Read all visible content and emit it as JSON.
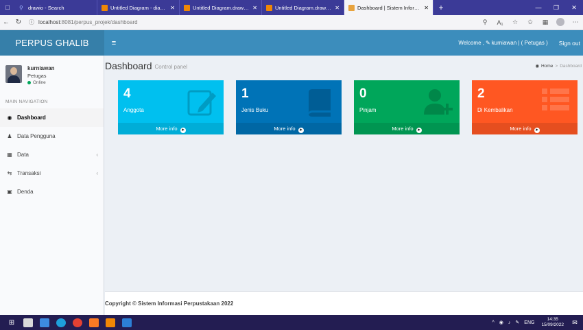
{
  "browser": {
    "tabs": [
      {
        "title": "drawio - Search",
        "favicon_color": "#3b3a97",
        "active": false
      },
      {
        "title": "Untitled Diagram - diagrams",
        "favicon_color": "#f08705",
        "active": false
      },
      {
        "title": "Untitled Diagram.drawio - d",
        "favicon_color": "#f08705",
        "active": false
      },
      {
        "title": "Untitled Diagram.drawio - d",
        "favicon_color": "#f08705",
        "active": false
      },
      {
        "title": "Dashboard | Sistem Informasi",
        "favicon_color": "#e8a33d",
        "active": true
      }
    ],
    "address": {
      "host": "localhost",
      "path": ":8081/perpus_projek/dashboard"
    }
  },
  "header": {
    "logo": "PERPUS GHALIB",
    "welcome": "Welcome ,",
    "user_link": "kurniawan | ( Petugas )",
    "signout": "Sign out"
  },
  "sidebar": {
    "user": {
      "name": "kurniawan",
      "role": "Petugas",
      "status": "Online"
    },
    "nav_header": "MAIN NAVIGATION",
    "items": [
      {
        "label": "Dashboard",
        "icon": "dashboard-icon",
        "active": true
      },
      {
        "label": "Data Pengguna",
        "icon": "user-icon"
      },
      {
        "label": "Data",
        "icon": "data-icon",
        "caret": true
      },
      {
        "label": "Transaksi",
        "icon": "exchange-icon",
        "caret": true
      },
      {
        "label": "Denda",
        "icon": "money-icon"
      }
    ]
  },
  "content": {
    "title": "Dashboard",
    "subtitle": "Control panel",
    "breadcrumb": {
      "home": "Home",
      "current": "Dashboard"
    },
    "boxes": [
      {
        "value": "4",
        "label": "Anggota",
        "footer": "More info",
        "color": "#00c0ef",
        "icon": "edit-icon"
      },
      {
        "value": "1",
        "label": "Jenis Buku",
        "footer": "More info",
        "color": "#0073b7",
        "icon": "book-icon"
      },
      {
        "value": "0",
        "label": "Pinjam",
        "footer": "More info",
        "color": "#00a65a",
        "icon": "user-plus-icon"
      },
      {
        "value": "2",
        "label": "Di Kembalikan",
        "footer": "More info",
        "color": "#ff5722",
        "icon": "list-icon"
      }
    ]
  },
  "footer": {
    "copyright": "Copyright © Sistem Informasi Perpustakaan 2022"
  },
  "taskbar": {
    "lang": "ENG",
    "time": "14:35",
    "date": "15/09/2022"
  }
}
